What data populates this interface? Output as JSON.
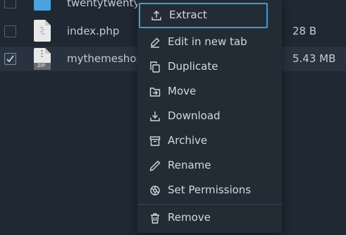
{
  "files": [
    {
      "name": "twentytwentyfive",
      "size": "",
      "checked": false,
      "icon": "folder-icon"
    },
    {
      "name": "index.php",
      "size": "28 B",
      "checked": false,
      "icon": "php-file-icon"
    },
    {
      "name": "mythemeshop",
      "size": "5.43 MB",
      "checked": true,
      "icon": "zip-file-icon",
      "icon_text": "ZIP"
    }
  ],
  "context_menu": {
    "items": [
      {
        "label": "Extract",
        "icon": "extract-icon"
      },
      {
        "label": "Edit in new tab",
        "icon": "edit-icon"
      },
      {
        "label": "Duplicate",
        "icon": "duplicate-icon"
      },
      {
        "label": "Move",
        "icon": "move-icon"
      },
      {
        "label": "Download",
        "icon": "download-icon"
      },
      {
        "label": "Archive",
        "icon": "archive-icon"
      },
      {
        "label": "Rename",
        "icon": "rename-icon"
      },
      {
        "label": "Set Permissions",
        "icon": "permissions-icon"
      },
      {
        "label": "Remove",
        "icon": "trash-icon"
      }
    ]
  },
  "colors": {
    "background": "#1f2833",
    "menu_background": "#232b35",
    "focus_outline": "#2fa2e0",
    "folder": "#4aa3df"
  }
}
